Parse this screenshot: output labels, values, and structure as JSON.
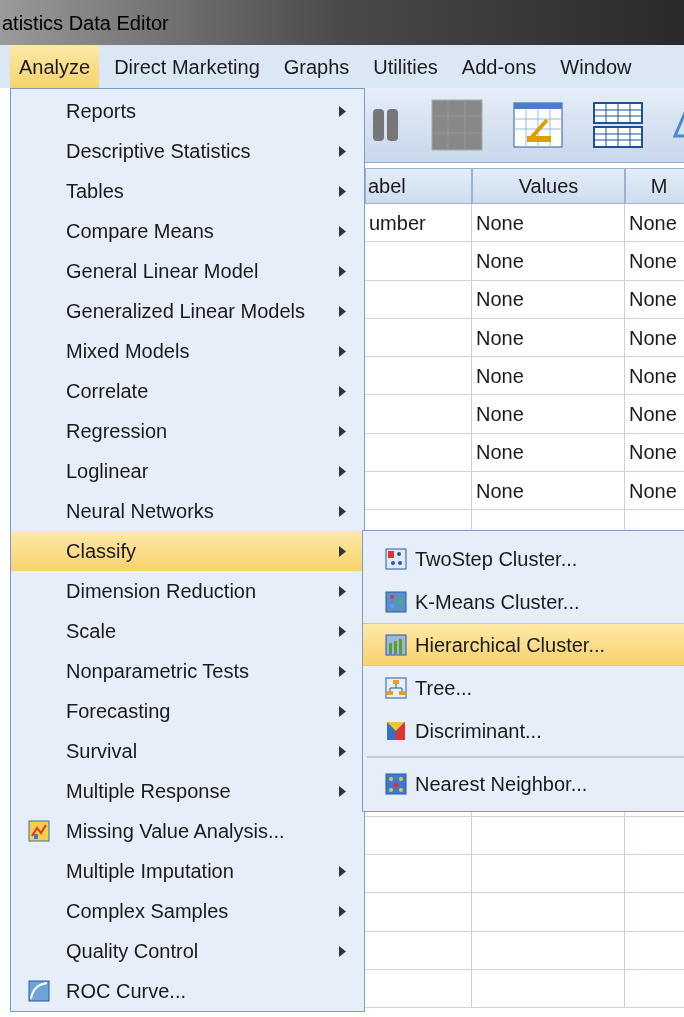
{
  "window": {
    "title": "atistics Data Editor"
  },
  "menu_bar": [
    {
      "label": "Analyze",
      "selected": true
    },
    {
      "label": "Direct Marketing",
      "selected": false
    },
    {
      "label": "Graphs",
      "selected": false
    },
    {
      "label": "Utilities",
      "selected": false
    },
    {
      "label": "Add-ons",
      "selected": false
    },
    {
      "label": "Window",
      "selected": false
    }
  ],
  "table": {
    "columns": [
      "abel",
      "Values",
      "M"
    ],
    "rows": [
      [
        "umber",
        "None",
        "None"
      ],
      [
        "",
        "None",
        "None"
      ],
      [
        "",
        "None",
        "None"
      ],
      [
        "",
        "None",
        "None"
      ],
      [
        "",
        "None",
        "None"
      ],
      [
        "",
        "None",
        "None"
      ],
      [
        "",
        "None",
        "None"
      ],
      [
        "",
        "None",
        "None"
      ]
    ]
  },
  "analyze_menu": [
    {
      "label": "Reports",
      "kind": "submenu",
      "selected": false
    },
    {
      "label": "Descriptive Statistics",
      "kind": "submenu",
      "selected": false
    },
    {
      "label": "Tables",
      "kind": "submenu",
      "selected": false
    },
    {
      "label": "Compare Means",
      "kind": "submenu",
      "selected": false
    },
    {
      "label": "General Linear Model",
      "kind": "submenu",
      "selected": false
    },
    {
      "label": "Generalized Linear Models",
      "kind": "submenu",
      "selected": false
    },
    {
      "label": "Mixed Models",
      "kind": "submenu",
      "selected": false
    },
    {
      "label": "Correlate",
      "kind": "submenu",
      "selected": false
    },
    {
      "label": "Regression",
      "kind": "submenu",
      "selected": false
    },
    {
      "label": "Loglinear",
      "kind": "submenu",
      "selected": false
    },
    {
      "label": "Neural Networks",
      "kind": "submenu",
      "selected": false
    },
    {
      "label": "Classify",
      "kind": "submenu",
      "selected": true
    },
    {
      "label": "Dimension Reduction",
      "kind": "submenu",
      "selected": false
    },
    {
      "label": "Scale",
      "kind": "submenu",
      "selected": false
    },
    {
      "label": "Nonparametric Tests",
      "kind": "submenu",
      "selected": false
    },
    {
      "label": "Forecasting",
      "kind": "submenu",
      "selected": false
    },
    {
      "label": "Survival",
      "kind": "submenu",
      "selected": false
    },
    {
      "label": "Multiple Response",
      "kind": "submenu",
      "selected": false
    },
    {
      "label": "Missing Value Analysis...",
      "kind": "missing",
      "selected": false
    },
    {
      "label": "Multiple Imputation",
      "kind": "submenu",
      "selected": false
    },
    {
      "label": "Complex Samples",
      "kind": "submenu",
      "selected": false
    },
    {
      "label": "Quality Control",
      "kind": "submenu",
      "selected": false
    },
    {
      "label": "ROC Curve...",
      "kind": "roc",
      "selected": false
    }
  ],
  "classify_menu": [
    {
      "label": "TwoStep Cluster...",
      "kind": "twostep",
      "selected": false
    },
    {
      "label": "K-Means Cluster...",
      "kind": "kmeans",
      "selected": false
    },
    {
      "label": "Hierarchical Cluster...",
      "kind": "hierarchical",
      "selected": true
    },
    {
      "label": "Tree...",
      "kind": "tree",
      "selected": false
    },
    {
      "label": "Discriminant...",
      "kind": "discriminant",
      "selected": false
    },
    {
      "label": "Nearest Neighbor...",
      "kind": "nearest",
      "selected": false
    }
  ]
}
